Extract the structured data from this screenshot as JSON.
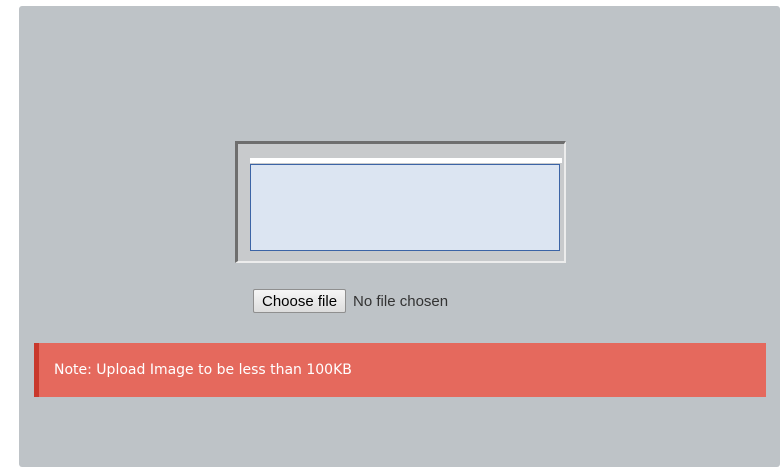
{
  "upload": {
    "button_label": "Choose file",
    "status_text": "No file chosen"
  },
  "note": {
    "text": "Note: Upload Image to be less than 100KB"
  },
  "colors": {
    "panel_bg": "#bec3c7",
    "preview_bg": "#dce5f2",
    "preview_border": "#3c64a6",
    "note_bg": "#e5695d",
    "note_accent": "#c9392d"
  }
}
